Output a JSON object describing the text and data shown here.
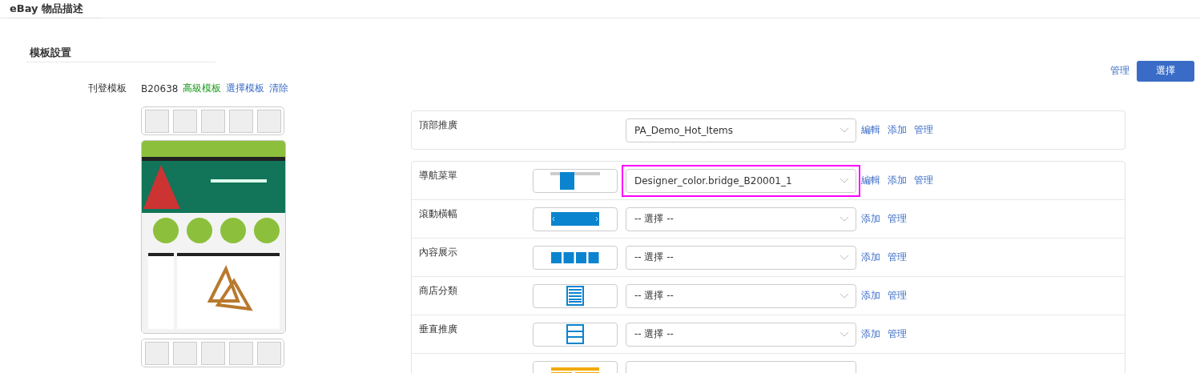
{
  "page_title": "eBay 物品描述",
  "section": {
    "title": "模板設置",
    "manage_link": "管理",
    "select_button": "選擇"
  },
  "listing_template": {
    "label": "刊登模板",
    "code": "B20638",
    "level_tag": "高級模板",
    "links": [
      "選擇模板",
      "清除"
    ]
  },
  "top_card": {
    "label": "頂部推廣",
    "value": "PA_Demo_Hot_Items",
    "links": [
      "編輯",
      "添加",
      "管理"
    ]
  },
  "rows": [
    {
      "label": "導航菜單",
      "kind": "nav",
      "value": "Designer_color.bridge_B20001_1",
      "highlighted": true,
      "links": [
        "編輯",
        "添加",
        "管理"
      ]
    },
    {
      "label": "滾動橫幅",
      "kind": "slider",
      "value": "-- 選擇 --",
      "highlighted": false,
      "links": [
        "添加",
        "管理"
      ]
    },
    {
      "label": "內容展示",
      "kind": "tiles",
      "value": "-- 選擇 --",
      "highlighted": false,
      "links": [
        "添加",
        "管理"
      ]
    },
    {
      "label": "商店分類",
      "kind": "list",
      "value": "-- 選擇 --",
      "highlighted": false,
      "links": [
        "添加",
        "管理"
      ]
    },
    {
      "label": "垂直推廣",
      "kind": "stack",
      "value": "-- 選擇 --",
      "highlighted": false,
      "links": [
        "添加",
        "管理"
      ]
    },
    {
      "kind": "title",
      "highlighted": false
    }
  ]
}
